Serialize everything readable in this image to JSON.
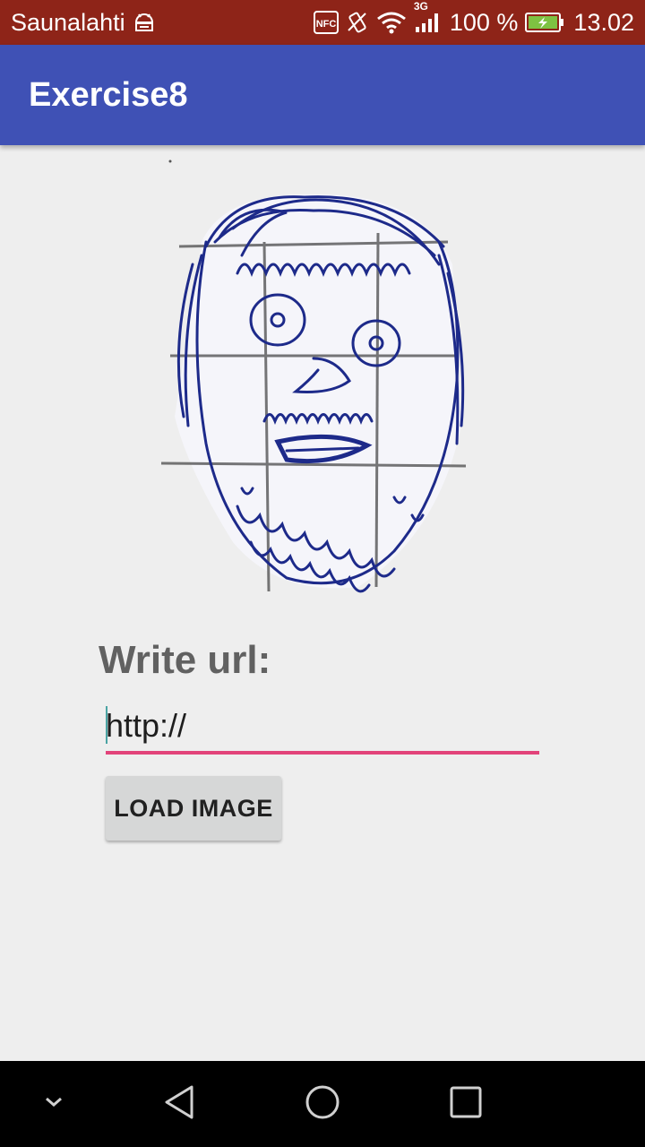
{
  "status_bar": {
    "carrier": "Saunalahti",
    "network_label": "3G",
    "battery_percent": "100 %",
    "time": "13.02",
    "nfc_label": "NFC",
    "icons": [
      "android-debug-icon",
      "nfc-icon",
      "vibrate-icon",
      "wifi-icon",
      "signal-icon",
      "battery-charging-icon"
    ]
  },
  "app_bar": {
    "title": "Exercise8"
  },
  "main": {
    "image_description_icon": "face-drawing-image",
    "label": "Write url:",
    "url_input": {
      "value": "http://",
      "placeholder": ""
    },
    "load_button_label": "LOAD IMAGE"
  },
  "nav_bar": {
    "icons": [
      "chevron-down-icon",
      "back-icon",
      "home-icon",
      "recents-icon"
    ]
  },
  "colors": {
    "status_bar": "#8e2418",
    "app_bar": "#3f51b5",
    "accent": "#e2437a",
    "background": "#eeeeee",
    "button": "#d6d7d7"
  }
}
